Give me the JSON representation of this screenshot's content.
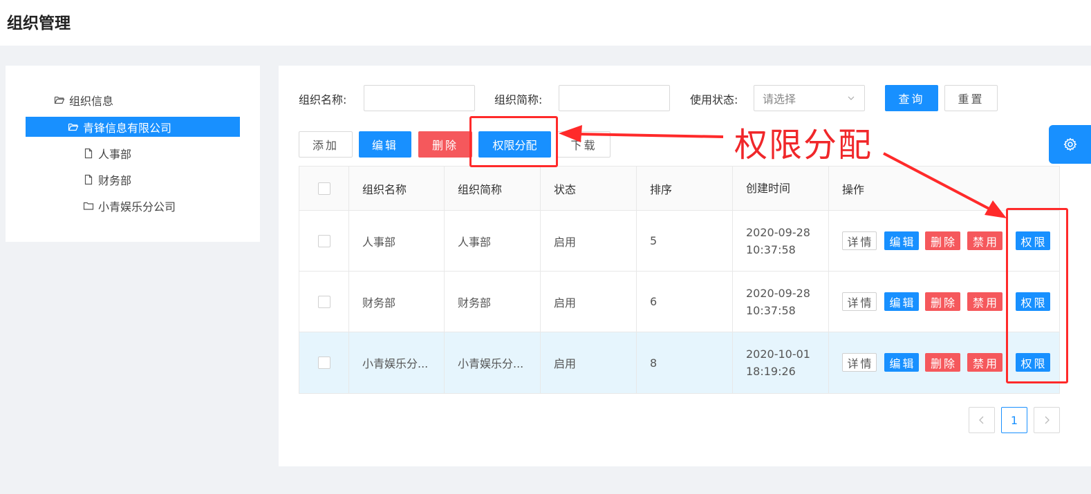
{
  "page": {
    "title": "组织管理"
  },
  "tree": {
    "root": "组织信息",
    "selected": "青锋信息有限公司",
    "children": [
      "人事部",
      "财务部",
      "小青娱乐分公司"
    ]
  },
  "search": {
    "name_label": "组织名称:",
    "abbr_label": "组织简称:",
    "status_label": "使用状态:",
    "status_placeholder": "请选择",
    "query_label": "查询",
    "reset_label": "重置"
  },
  "toolbar": {
    "add_label": "添加",
    "edit_label": "编辑",
    "delete_label": "删除",
    "perm_label": "权限分配",
    "download_label": "下载"
  },
  "table": {
    "headers": [
      "组织名称",
      "组织简称",
      "状态",
      "排序",
      "创建时间",
      "操作"
    ],
    "rows": [
      {
        "name": "人事部",
        "abbr": "人事部",
        "status": "启用",
        "sort": "5",
        "time": "2020-09-28\n10:37:58"
      },
      {
        "name": "财务部",
        "abbr": "财务部",
        "status": "启用",
        "sort": "6",
        "time": "2020-09-28\n10:37:58"
      },
      {
        "name": "小青娱乐分...",
        "abbr": "小青娱乐分...",
        "status": "启用",
        "sort": "8",
        "time": "2020-10-01\n18:19:26"
      }
    ],
    "ops": {
      "detail": "详情",
      "edit": "编辑",
      "delete": "删除",
      "disable": "禁用",
      "perm": "权限"
    }
  },
  "pagination": {
    "current": "1",
    "prev_icon": "chevron-left-icon",
    "next_icon": "chevron-right-icon"
  },
  "annotation": {
    "text": "权限分配",
    "color": "#f0272a"
  },
  "colors": {
    "primary": "#1890ff",
    "danger": "#f5585c",
    "highlight_row": "#e6f5fd"
  },
  "icons": {
    "settings": "gear-icon",
    "folder": "folder-icon",
    "file": "file-icon"
  }
}
